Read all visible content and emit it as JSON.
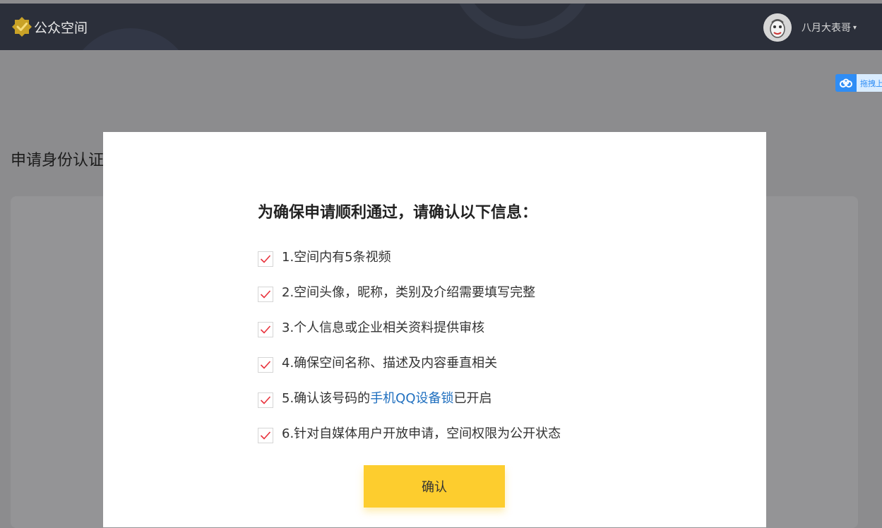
{
  "header": {
    "logo_text": "公众空间",
    "username": "八月大表哥",
    "caret": "▾"
  },
  "baidu_badge": {
    "text": "拖拽上"
  },
  "background": {
    "page_title": "申请身份认证"
  },
  "modal": {
    "title": "为确保申请顺利通过，请确认以下信息：",
    "items": [
      {
        "text": "1.空间内有5条视频"
      },
      {
        "text": "2.空间头像，昵称，类别及介绍需要填写完整"
      },
      {
        "text": "3.个人信息或企业相关资料提供审核"
      },
      {
        "text": "4.确保空间名称、描述及内容垂直相关"
      },
      {
        "prefix": "5.确认该号码的",
        "link": "手机QQ设备锁",
        "suffix": "已开启"
      },
      {
        "text": "6.针对自媒体用户开放申请，空间权限为公开状态"
      }
    ],
    "confirm_label": "确认"
  },
  "colors": {
    "header_bg": "#2b2f3a",
    "accent_yellow": "#fdcd2e",
    "check_red": "#e8323c",
    "link_blue": "#1f6fbf",
    "overlay": "#8c8c8e"
  },
  "icons": {
    "logo": "shield-check-icon",
    "avatar": "avatar-icon",
    "checkbox": "check-icon",
    "baidu": "baidu-cloud-icon"
  }
}
